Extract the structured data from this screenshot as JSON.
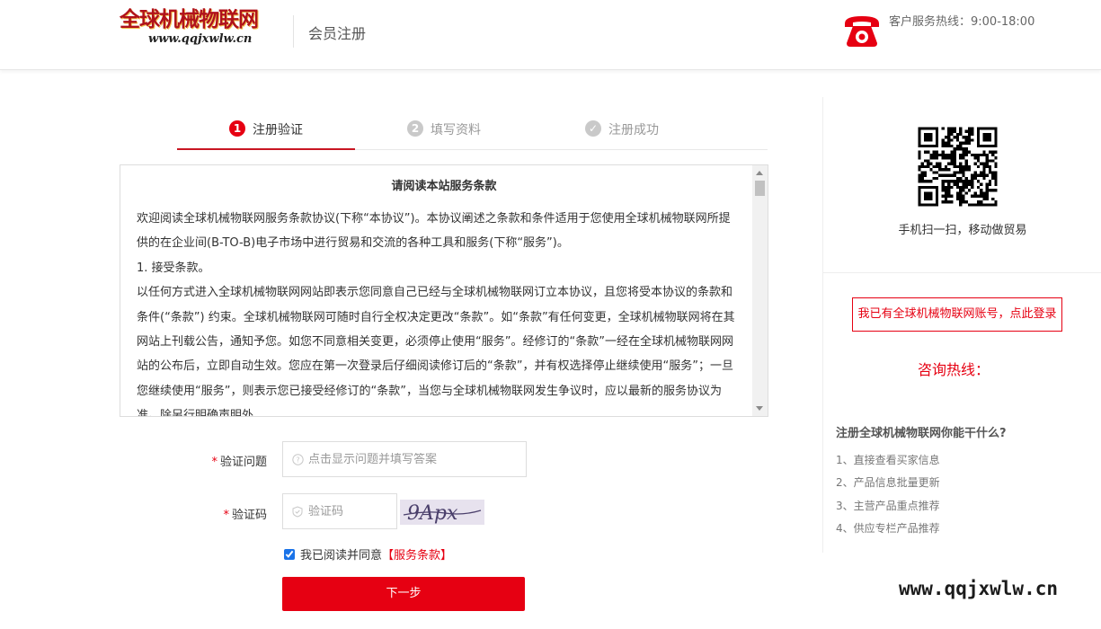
{
  "header": {
    "logo_text": "全球机械物联网",
    "logo_url": "www.qqjxwlw.cn",
    "title": "会员注册",
    "hotline": "客户服务热线：9:00-18:00"
  },
  "steps": [
    {
      "num": "1",
      "label": "注册验证",
      "state": "active"
    },
    {
      "num": "2",
      "label": "填写资料",
      "state": "inactive"
    },
    {
      "num": "✓",
      "label": "注册成功",
      "state": "inactive"
    }
  ],
  "terms": {
    "title": "请阅读本站服务条款",
    "body": "欢迎阅读全球机械物联网服务条款协议(下称“本协议”)。本协议阐述之条款和条件适用于您使用全球机械物联网所提供的在企业间(B-TO-B)电子市场中进行贸易和交流的各种工具和服务(下称“服务”)。\n1. 接受条款。\n以任何方式进入全球机械物联网网站即表示您同意自己已经与全球机械物联网订立本协议，且您将受本协议的条款和条件(“条款”) 约束。全球机械物联网可随时自行全权决定更改“条款”。如“条款”有任何变更，全球机械物联网将在其网站上刊载公告，通知予您。如您不同意相关变更，必须停止使用“服务”。经修订的“条款”一经在全球机械物联网网站的公布后，立即自动生效。您应在第一次登录后仔细阅读修订后的“条款”，并有权选择停止继续使用“服务”；一旦您继续使用“服务”，则表示您已接受经修订的“条款”，当您与全球机械物联网发生争议时，应以最新的服务协议为准。除另行明确声明外，"
  },
  "form": {
    "question_label": "验证问题",
    "question_placeholder": "点击显示问题并填写答案",
    "captcha_label": "验证码",
    "captcha_placeholder": "验证码",
    "captcha_text": "9Apx",
    "agree_text": "我已阅读并同意",
    "agree_link": "【服务条款】",
    "agree_checked": true,
    "next_button": "下一步"
  },
  "side": {
    "qr_caption": "手机扫一扫，移动做贸易",
    "login_link": "我已有全球机械物联网账号，点此登录",
    "consult_label": "咨询热线：",
    "why_title": "注册全球机械物联网你能干什么?",
    "why_items": [
      "1、直接查看买家信息",
      "2、产品信息批量更新",
      "3、主营产品重点推荐",
      "4、供应专栏产品推荐"
    ]
  },
  "watermark": "www.qqjxwlw.cn",
  "colors": {
    "brand_red": "#e60012",
    "active_underline": "#c81623"
  }
}
